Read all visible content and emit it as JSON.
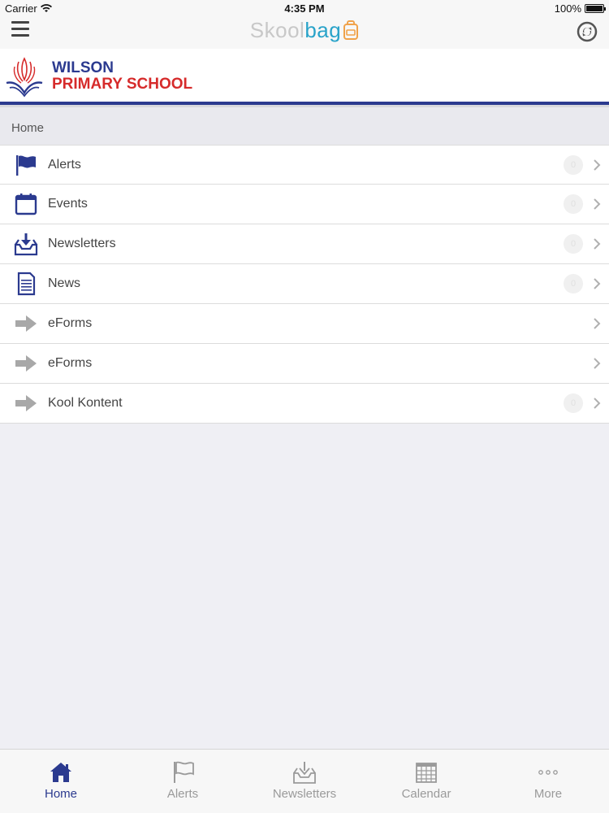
{
  "status_bar": {
    "carrier": "Carrier",
    "time": "4:35 PM",
    "battery": "100%"
  },
  "nav": {
    "brand_part1": "Skool",
    "brand_part2": "bag"
  },
  "school": {
    "name_line1": "WILSON",
    "name_line2": "PRIMARY SCHOOL"
  },
  "breadcrumb": "Home",
  "menu": [
    {
      "label": "Alerts",
      "icon": "flag-icon",
      "has_badge": true,
      "badge": "0"
    },
    {
      "label": "Events",
      "icon": "calendar-icon",
      "has_badge": true,
      "badge": "0"
    },
    {
      "label": "Newsletters",
      "icon": "inbox-download-icon",
      "has_badge": true,
      "badge": "0"
    },
    {
      "label": "News",
      "icon": "document-icon",
      "has_badge": true,
      "badge": "0"
    },
    {
      "label": "eForms",
      "icon": "arrow-right-icon",
      "has_badge": false
    },
    {
      "label": "eForms",
      "icon": "arrow-right-icon",
      "has_badge": false
    },
    {
      "label": "Kool Kontent",
      "icon": "arrow-right-icon",
      "has_badge": true,
      "badge": "0"
    }
  ],
  "tabs": [
    {
      "label": "Home",
      "icon": "home-icon",
      "active": true
    },
    {
      "label": "Alerts",
      "icon": "flag-icon",
      "active": false
    },
    {
      "label": "Newsletters",
      "icon": "inbox-download-icon",
      "active": false
    },
    {
      "label": "Calendar",
      "icon": "calendar-grid-icon",
      "active": false
    },
    {
      "label": "More",
      "icon": "more-dots-icon",
      "active": false
    }
  ],
  "colors": {
    "primary": "#2b3a8f",
    "accent_red": "#d62b2b",
    "brand_blue": "#29a3c9",
    "inactive": "#9a9a9a"
  }
}
